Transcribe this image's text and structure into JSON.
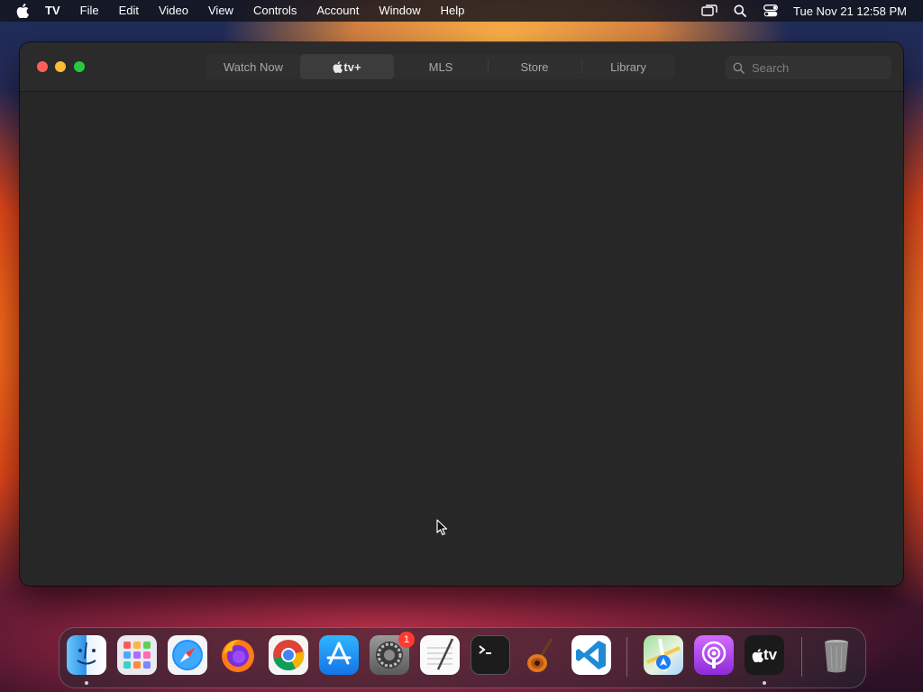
{
  "menubar": {
    "app_name": "TV",
    "items": [
      "File",
      "Edit",
      "Video",
      "View",
      "Controls",
      "Account",
      "Window",
      "Help"
    ],
    "clock": "Tue Nov 21  12:58 PM",
    "icons": [
      "apple-icon",
      "screen-mirroring-icon",
      "spotlight-search-icon",
      "control-center-icon"
    ]
  },
  "window": {
    "tabs": [
      {
        "label": "Watch Now",
        "active": false
      },
      {
        "label": "tv+",
        "active": true
      },
      {
        "label": "MLS",
        "active": false
      },
      {
        "label": "Store",
        "active": false
      },
      {
        "label": "Library",
        "active": false
      }
    ],
    "search": {
      "placeholder": "Search",
      "value": ""
    }
  },
  "dock": {
    "apps": [
      "Finder",
      "Launchpad",
      "Safari",
      "Firefox",
      "Google Chrome",
      "App Store",
      "System Settings",
      "TextEdit",
      "Terminal",
      "GarageBand",
      "Visual Studio Code",
      "Maps",
      "Podcasts",
      "TV",
      "Trash"
    ],
    "settings_badge": "1",
    "tv_label": "tv"
  },
  "colors": {
    "window_bg": "#272727",
    "close": "#ff5f57",
    "minimize": "#febc2e",
    "maximize": "#28c840",
    "badge": "#ff3b30"
  }
}
